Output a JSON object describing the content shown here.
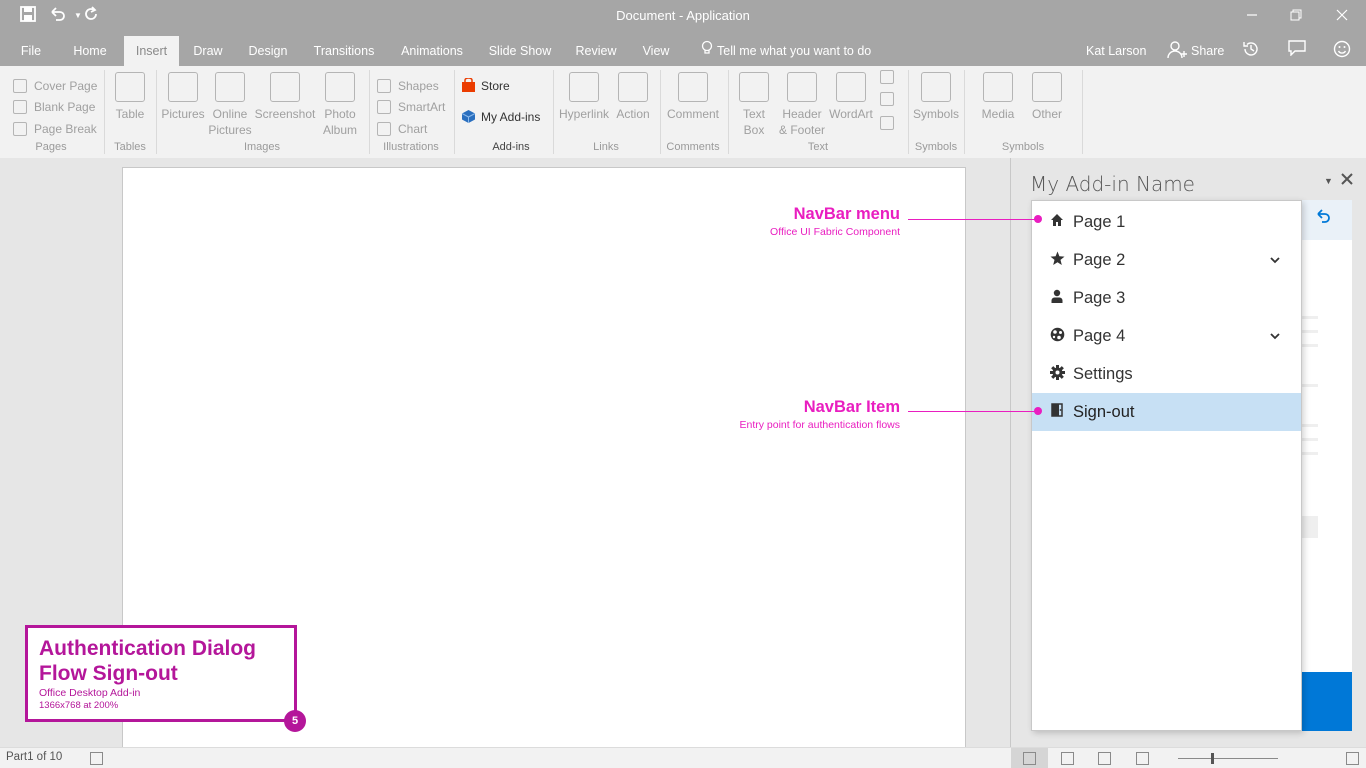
{
  "titlebar": {
    "title": "Document - Application",
    "quick_access": [
      "save-icon",
      "undo-icon",
      "redo-icon"
    ],
    "window_controls": [
      "minimize-icon",
      "restore-icon",
      "close-icon"
    ]
  },
  "tabs": [
    "File",
    "Home",
    "Insert",
    "Draw",
    "Design",
    "Transitions",
    "Animations",
    "Slide Show",
    "Review",
    "View"
  ],
  "active_tab": "Insert",
  "tell_me": "Tell me what you want to do",
  "user": "Kat Larson",
  "share": "Share",
  "ribbon": {
    "pages": {
      "items": [
        "Cover Page",
        "Blank Page",
        "Page Break"
      ],
      "label": "Pages"
    },
    "tables": {
      "button": "Table",
      "label": "Tables"
    },
    "images": {
      "buttons": [
        [
          "Pictures",
          ""
        ],
        [
          "Online",
          "Pictures"
        ],
        [
          "Screenshot",
          ""
        ],
        [
          "Photo",
          "Album"
        ]
      ],
      "label": "Images"
    },
    "illustrations": {
      "items": [
        "Shapes",
        "SmartArt",
        "Chart"
      ],
      "label": "Illustrations"
    },
    "addins": {
      "store": "Store",
      "my_addins": "My Add-ins",
      "label": "Add-ins"
    },
    "links": {
      "buttons": [
        "Hyperlink",
        "Action"
      ],
      "label": "Links"
    },
    "comments": {
      "button": "Comment",
      "label": "Comments"
    },
    "text": {
      "buttons": [
        [
          "Text",
          "Box"
        ],
        [
          "Header",
          "& Footer"
        ],
        [
          "WordArt",
          ""
        ]
      ],
      "label": "Text"
    },
    "symbols": {
      "button": "Symbols",
      "label": "Symbols"
    },
    "media": {
      "buttons": [
        "Media",
        "Other"
      ],
      "label": "Symbols"
    }
  },
  "taskpane": {
    "title": "My Add-in Name"
  },
  "navbar": {
    "items": [
      {
        "label": "Page 1",
        "icon": "home-icon",
        "chevron": false
      },
      {
        "label": "Page 2",
        "icon": "star-icon",
        "chevron": true
      },
      {
        "label": "Page 3",
        "icon": "person-icon",
        "chevron": false
      },
      {
        "label": "Page 4",
        "icon": "globe-icon",
        "chevron": true
      },
      {
        "label": "Settings",
        "icon": "gear-icon",
        "chevron": false
      },
      {
        "label": "Sign-out",
        "icon": "door-icon",
        "chevron": false,
        "selected": true
      }
    ]
  },
  "callouts": {
    "menu": {
      "title": "NavBar menu",
      "subtitle": "Office UI Fabric Component"
    },
    "item": {
      "title": "NavBar Item",
      "subtitle": "Entry point for authentication flows"
    }
  },
  "info": {
    "title": "Authentication Dialog Flow Sign-out",
    "subtitle": "Office Desktop Add-in",
    "resolution": "1366x768 at 200%",
    "step": "5"
  },
  "status": {
    "page": "Part1 of 10"
  },
  "colors": {
    "accent": "#0078d7",
    "callout": "#e91ec0",
    "infobox": "#b4169a",
    "selected": "#c7e0f4"
  }
}
